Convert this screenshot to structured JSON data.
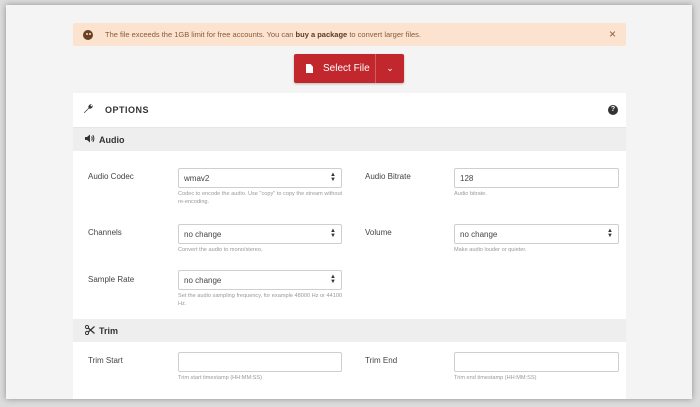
{
  "alert": {
    "message_before": "The file exceeds the 1GB limit for free accounts. You can ",
    "message_link": "buy a package",
    "message_after": " to convert larger files.",
    "close_symbol": "×"
  },
  "select_file": {
    "label": "Select File",
    "caret": "⌄"
  },
  "options": {
    "title": "OPTIONS",
    "help_symbol": "?"
  },
  "audio": {
    "section_title": "Audio",
    "codec": {
      "label": "Audio Codec",
      "value": "wmav2",
      "help": "Codec to encode the audio. Use \"copy\" to copy the stream without re-encoding."
    },
    "bitrate": {
      "label": "Audio Bitrate",
      "value": "128",
      "help": "Audio bitrate."
    },
    "channels": {
      "label": "Channels",
      "value": "no change",
      "help": "Convert the audio to mono/stereo."
    },
    "volume": {
      "label": "Volume",
      "value": "no change",
      "help": "Make audio louder or quieter."
    },
    "sample_rate": {
      "label": "Sample Rate",
      "value": "no change",
      "help": "Set the audio sampling frequency, for example 48000 Hz or 44100 Hz."
    }
  },
  "trim": {
    "section_title": "Trim",
    "start": {
      "label": "Trim Start",
      "value": "",
      "help": "Trim start timestamp (HH:MM:SS)"
    },
    "end": {
      "label": "Trim End",
      "value": "",
      "help": "Trim end timestamp (HH:MM:SS)"
    }
  },
  "icons": {
    "alert": "sad-face-icon",
    "file": "file-icon",
    "options": "wrench-icon",
    "help": "question-icon",
    "audio": "speaker-icon",
    "trim": "scissors-icon"
  },
  "colors": {
    "primary": "#c1272d",
    "alert_bg": "#fbe3cf",
    "section_bg": "#eeeeee"
  }
}
